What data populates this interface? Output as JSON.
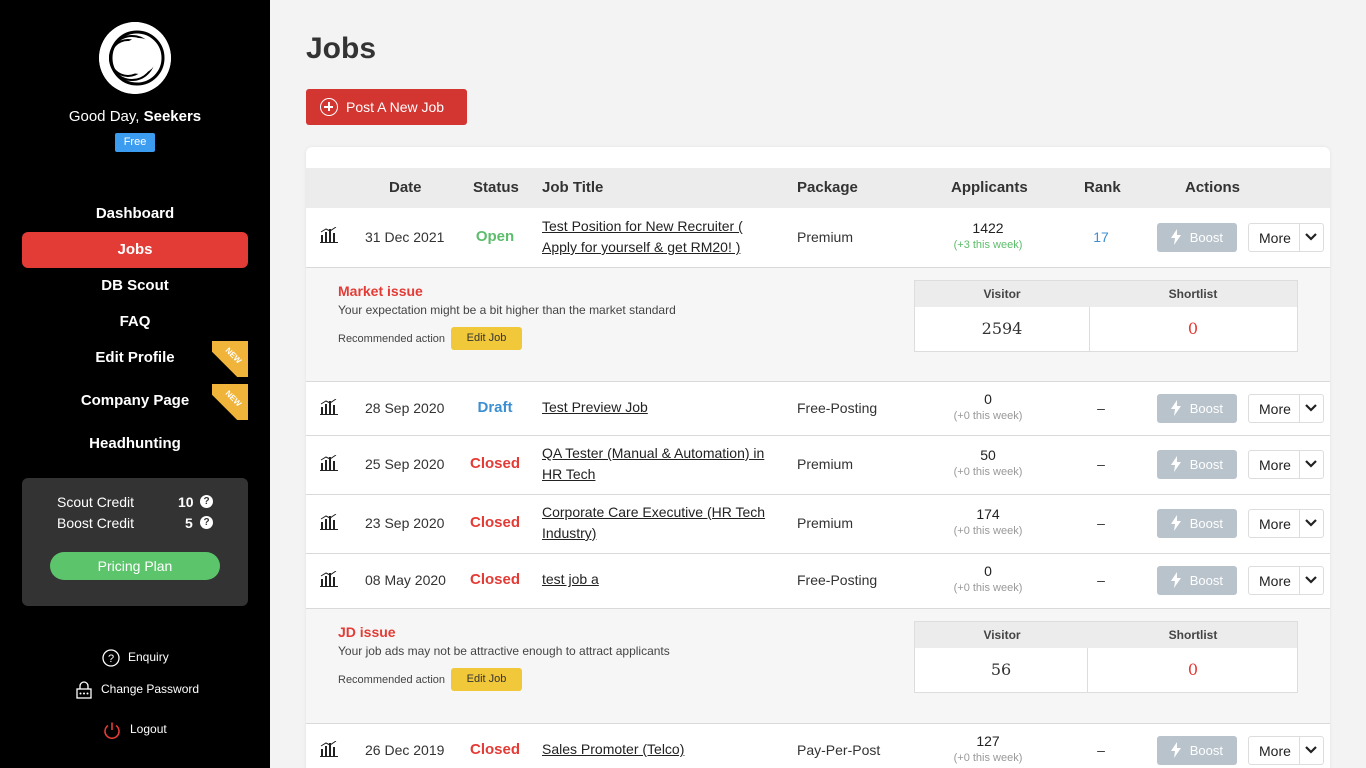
{
  "sidebar": {
    "greeting_prefix": "Good Day, ",
    "user_name": "Seekers",
    "plan_badge": "Free",
    "nav": [
      {
        "label": "Dashboard",
        "active": false
      },
      {
        "label": "Jobs",
        "active": true
      },
      {
        "label": "DB Scout",
        "active": false
      },
      {
        "label": "FAQ",
        "active": false
      },
      {
        "label": "Edit Profile",
        "active": false,
        "badge": "NEW"
      },
      {
        "label": "Company Page",
        "active": false,
        "badge": "NEW"
      },
      {
        "label": "Headhunting",
        "active": false
      }
    ],
    "credits": {
      "scout_label": "Scout Credit",
      "scout_value": "10",
      "boost_label": "Boost Credit",
      "boost_value": "5",
      "help_glyph": "?",
      "pricing_label": "Pricing Plan"
    },
    "links": {
      "enquiry": "Enquiry",
      "change_password": "Change Password",
      "logout": "Logout"
    }
  },
  "main": {
    "title": "Jobs",
    "post_button": "Post A New Job",
    "table": {
      "headers": {
        "date": "Date",
        "status": "Status",
        "job_title": "Job Title",
        "package": "Package",
        "applicants": "Applicants",
        "rank": "Rank",
        "actions": "Actions"
      },
      "boost_label": "Boost",
      "more_label": "More",
      "rows": [
        {
          "date": "31 Dec 2021",
          "status": "Open",
          "title": "Test Position for New Recruiter ( Apply for yourself & get RM20! )",
          "package": "Premium",
          "applicants": "1422",
          "week": "(+3 this week)",
          "rank": "17"
        },
        {
          "date": "28 Sep 2020",
          "status": "Draft",
          "title": "Test Preview Job",
          "package": "Free-Posting",
          "applicants": "0",
          "week": "(+0 this week)",
          "rank": "–"
        },
        {
          "date": "25 Sep 2020",
          "status": "Closed",
          "title": "QA Tester (Manual & Automation) in HR Tech",
          "package": "Premium",
          "applicants": "50",
          "week": "(+0 this week)",
          "rank": "–"
        },
        {
          "date": "23 Sep 2020",
          "status": "Closed",
          "title": "Corporate Care Executive (HR Tech Industry)",
          "package": "Premium",
          "applicants": "174",
          "week": "(+0 this week)",
          "rank": "–"
        },
        {
          "date": "08 May 2020",
          "status": "Closed",
          "title": "test job a",
          "package": "Free-Posting",
          "applicants": "0",
          "week": "(+0 this week)",
          "rank": "–"
        },
        {
          "date": "26 Dec 2019",
          "status": "Closed",
          "title": "Sales Promoter (Telco)",
          "package": "Pay-Per-Post",
          "applicants": "127",
          "week": "(+0 this week)",
          "rank": "–"
        }
      ],
      "issues": [
        {
          "title": "Market issue",
          "desc": "Your expectation might be a bit higher than the market standard",
          "rec_label": "Recommended action",
          "action": "Edit Job",
          "visitor_label": "Visitor",
          "shortlist_label": "Shortlist",
          "visitor": "2594",
          "shortlist": "0"
        },
        {
          "title": "JD issue",
          "desc": "Your job ads may not be attractive enough to attract applicants",
          "rec_label": "Recommended action",
          "action": "Edit Job",
          "visitor_label": "Visitor",
          "shortlist_label": "Shortlist",
          "visitor": "56",
          "shortlist": "0"
        }
      ]
    }
  },
  "colors": {
    "accent_red": "#e33b35",
    "open_green": "#5cbd6b",
    "draft_blue": "#3c8fd1",
    "edit_yellow": "#f1c839",
    "plan_blue": "#3b9cf0"
  }
}
